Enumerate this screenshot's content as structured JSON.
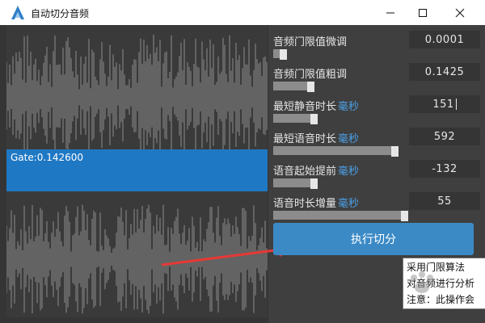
{
  "window": {
    "title": "自动切分音频",
    "icons": [
      "app-logo-icon",
      "minimize-icon",
      "maximize-icon",
      "close-icon"
    ]
  },
  "waveform": {
    "gate_label": "Gate:0.142600",
    "colors": {
      "wave": "#8c8c8c",
      "gate_band": "#1f78c4",
      "arrow": "#e53935"
    }
  },
  "controls": {
    "rows": [
      {
        "label": "音频门限值微调",
        "unit": "",
        "value": "0.0001",
        "slider_fraction": 0.02
      },
      {
        "label": "音频门限值粗调",
        "unit": "",
        "value": "0.1425",
        "slider_fraction": 0.25
      },
      {
        "label": "最短静音时长",
        "unit": "毫秒",
        "value": "151",
        "slider_fraction": 0.08
      },
      {
        "label": "最短语音时长",
        "unit": "毫秒",
        "value": "592",
        "slider_fraction": 0.62
      },
      {
        "label": "语音起始提前",
        "unit": "毫秒",
        "value": "-132",
        "slider_fraction": 0.18
      },
      {
        "label": "语音时长增量",
        "unit": "毫秒",
        "value": "55",
        "slider_fraction": 0.68
      }
    ],
    "run_label": "执行切分",
    "colors": {
      "accent": "#3b8ac6",
      "unit_text": "#4aa0e8"
    }
  },
  "tooltip": {
    "lines": [
      "采用门限算法",
      "对音频进行分析",
      "注意：此操作会"
    ]
  }
}
